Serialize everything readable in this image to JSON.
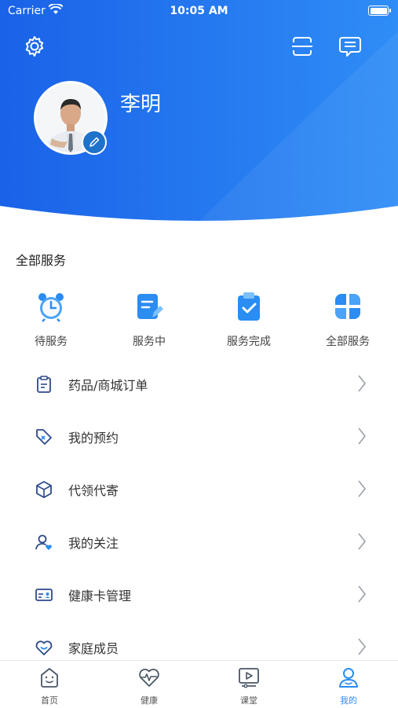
{
  "status_bar": {
    "carrier": "Carrier",
    "time": "10:05 AM"
  },
  "profile": {
    "name": "李明"
  },
  "services": {
    "title": "全部服务",
    "items": [
      {
        "label": "待服务",
        "icon": "alarm-clock-icon"
      },
      {
        "label": "服务中",
        "icon": "document-edit-icon"
      },
      {
        "label": "服务完成",
        "icon": "clipboard-check-icon"
      },
      {
        "label": "全部服务",
        "icon": "four-petal-grid-icon"
      }
    ]
  },
  "menu": [
    {
      "label": "药品/商城订单",
      "icon": "clipboard-icon"
    },
    {
      "label": "我的预约",
      "icon": "tag-icon"
    },
    {
      "label": "代领代寄",
      "icon": "package-icon"
    },
    {
      "label": "我的关注",
      "icon": "user-heart-icon"
    },
    {
      "label": "健康卡管理",
      "icon": "id-card-icon"
    },
    {
      "label": "家庭成员",
      "icon": "heart-smile-icon"
    }
  ],
  "tabbar": [
    {
      "label": "首页",
      "icon": "home-face-icon",
      "active": false
    },
    {
      "label": "健康",
      "icon": "heartbeat-icon",
      "active": false
    },
    {
      "label": "课堂",
      "icon": "video-class-icon",
      "active": false
    },
    {
      "label": "我的",
      "icon": "profile-icon",
      "active": true
    }
  ],
  "colors": {
    "primary": "#2b8cf2",
    "header_dark": "#1a66e6",
    "header_light": "#2f86f5"
  }
}
